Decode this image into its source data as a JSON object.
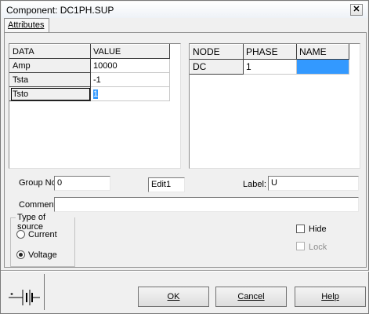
{
  "window": {
    "title": "Component: DC1PH.SUP",
    "close_glyph": "✕"
  },
  "tabs": [
    {
      "label": "Attributes"
    }
  ],
  "data_grid": {
    "headers": [
      "DATA",
      "VALUE"
    ],
    "rows": [
      {
        "name": "Amp",
        "value": "10000"
      },
      {
        "name": "Tsta",
        "value": "-1"
      },
      {
        "name": "Tsto",
        "value": "1"
      }
    ]
  },
  "node_grid": {
    "headers": [
      "NODE",
      "PHASE",
      "NAME"
    ],
    "rows": [
      {
        "node": "DC",
        "phase": "1",
        "name": ""
      }
    ]
  },
  "form": {
    "group_no_label": "Group No:",
    "group_no_value": "0",
    "edit_value": "Edit1",
    "label_label": "Label:",
    "label_value": "U",
    "comment_label": "Comment:",
    "comment_value": ""
  },
  "source_type": {
    "legend": "Type of source",
    "options": [
      {
        "label": "Current",
        "selected": false
      },
      {
        "label": "Voltage",
        "selected": true
      }
    ]
  },
  "checkboxes": {
    "hide": "Hide",
    "lock": "Lock"
  },
  "buttons": {
    "ok": "OK",
    "cancel": "Cancel",
    "help": "Help"
  },
  "icons": {
    "component_symbol": "dc-voltage-source-icon"
  },
  "colors": {
    "selection": "#3399ff"
  }
}
